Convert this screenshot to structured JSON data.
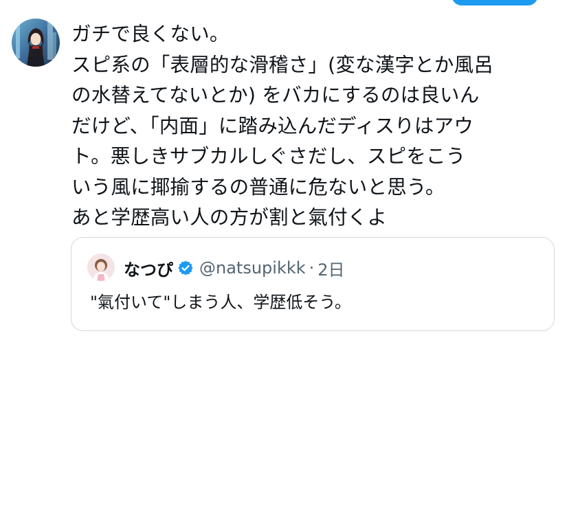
{
  "tweet": {
    "lines": [
      "ガチで良くない。",
      "スピ系の「表層的な滑稽さ」(変な漢字とか風呂",
      "の水替えてないとか) をバカにするのは良いん",
      "だけど、「内面」に踏み込んだディスりはアウ",
      "ト。悪しきサブカルしぐさだし、スピをこう",
      "いう風に揶揄するの普通に危ないと思う。",
      "あと学歴高い人の方が割と氣付くよ"
    ]
  },
  "quote": {
    "name": "なつぴ",
    "handle": "@natsupikkk",
    "dot": "·",
    "time": "2日",
    "text": "\"氣付いて\"しまう人、学歴低そう。"
  },
  "colors": {
    "accent": "#1d9bf0",
    "text": "#0f1419",
    "muted": "#536471",
    "border": "#cfd9de"
  },
  "icons": {
    "verified": "verified-badge-icon",
    "avatar": "user-avatar",
    "quote_avatar": "quoted-user-avatar"
  }
}
